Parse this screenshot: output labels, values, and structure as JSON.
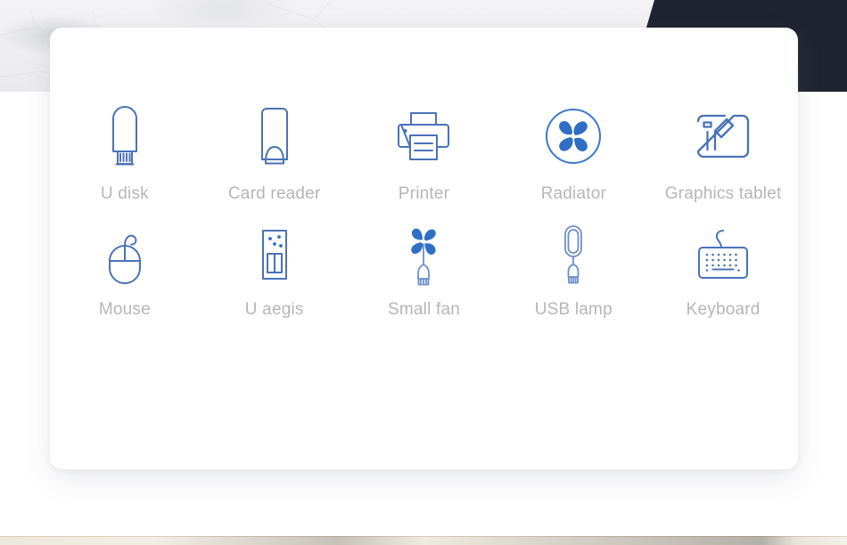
{
  "page": {
    "title": "USB accessories product feature grid",
    "card_background": "#ffffff",
    "background_top_dark": "#1f2430",
    "background_top_marble": "#eeeef1",
    "icon_color": "#4a72b8",
    "icon_fill_color": "#2f6ec4",
    "label_color": "#b6b6b8"
  },
  "grid": {
    "columns": 5,
    "rows": [
      {
        "row_name": "row-1",
        "items": [
          {
            "id": "u-disk",
            "label": "U disk",
            "icon": "usb-flash-drive-icon"
          },
          {
            "id": "card-reader",
            "label": "Card reader",
            "icon": "card-reader-icon"
          },
          {
            "id": "printer",
            "label": "Printer",
            "icon": "printer-icon"
          },
          {
            "id": "radiator",
            "label": "Radiator",
            "icon": "fan-radiator-icon"
          },
          {
            "id": "graphics-tablet",
            "label": "Graphics tablet",
            "icon": "graphics-tablet-icon"
          }
        ]
      },
      {
        "row_name": "row-2",
        "items": [
          {
            "id": "mouse",
            "label": "Mouse",
            "icon": "mouse-icon"
          },
          {
            "id": "u-aegis",
            "label": "U aegis",
            "icon": "u-aegis-device-icon"
          },
          {
            "id": "small-fan",
            "label": "Small fan",
            "icon": "small-fan-icon"
          },
          {
            "id": "usb-lamp",
            "label": "USB lamp",
            "icon": "usb-lamp-icon"
          },
          {
            "id": "keyboard",
            "label": "Keyboard",
            "icon": "keyboard-icon"
          }
        ]
      }
    ]
  }
}
